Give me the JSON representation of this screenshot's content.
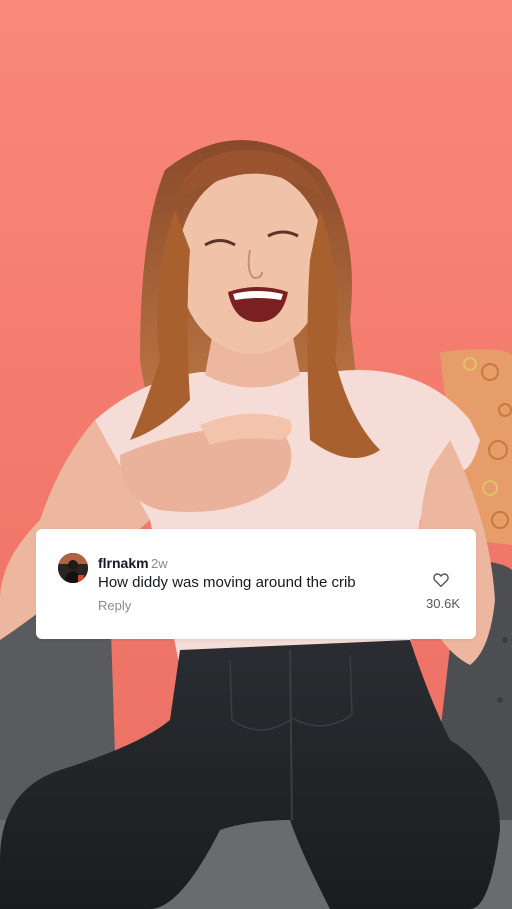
{
  "comment": {
    "username": "flrnakm",
    "timestamp": "2w",
    "text": "How diddy was moving around the crib",
    "reply_label": "Reply",
    "like_count": "30.6K",
    "like_icon": "heart-outline-icon",
    "avatar_icon": "user-avatar"
  },
  "colors": {
    "background": "#f57f72",
    "card": "#ffffff",
    "username": "#161823",
    "muted": "#8a8b91"
  }
}
